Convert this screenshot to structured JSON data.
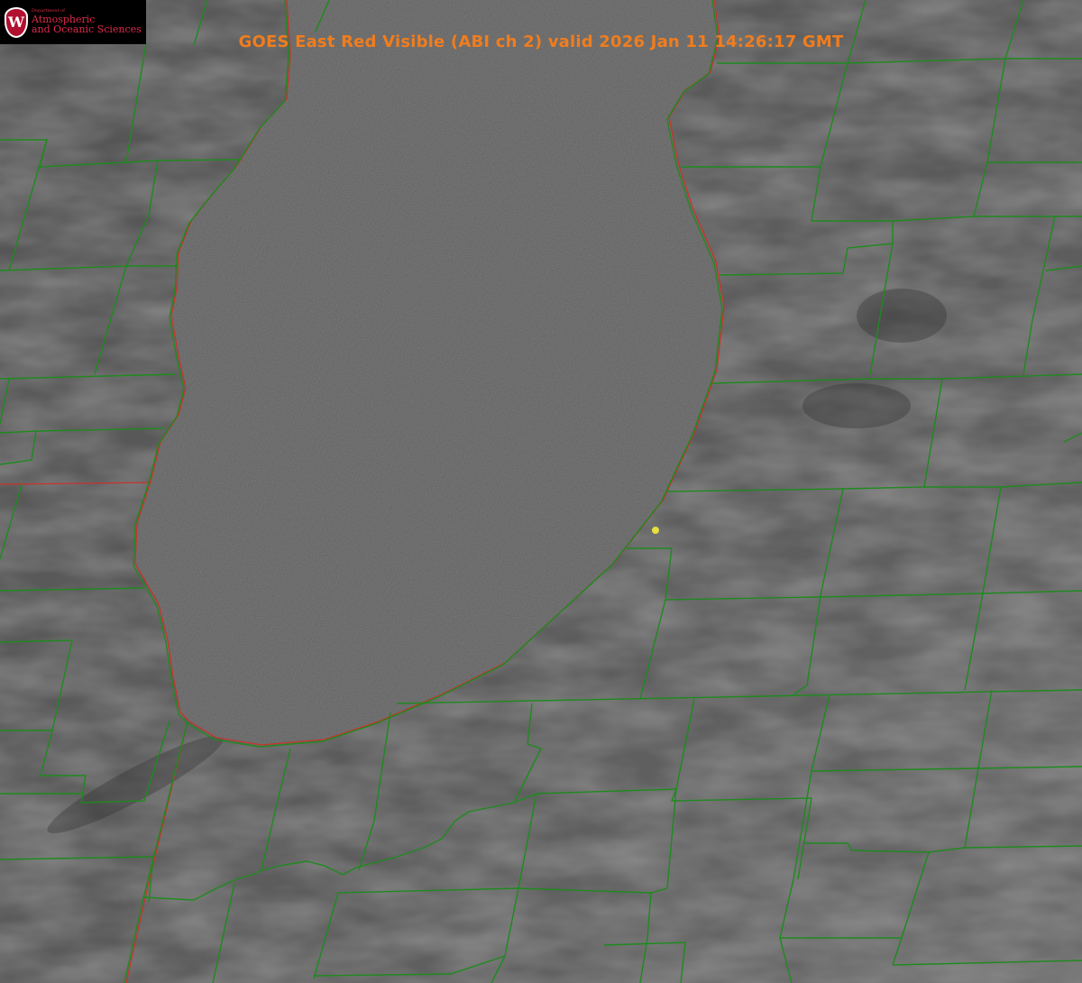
{
  "title": "GOES East Red Visible (ABI ch 2) valid 2026 Jan 11 14:26:17 GMT",
  "logo": {
    "badge_letter": "W",
    "department": "Department of",
    "line1": "Atmospheric",
    "line2": "and Oceanic Sciences"
  },
  "colors": {
    "county_lines": "#1e8a1e",
    "state_lines": "#c8322d",
    "title": "#f07d1e",
    "marker": "#e8e040",
    "logo_bg": "#000000",
    "logo_red": "#b2102f"
  },
  "map": {
    "feature": "lake-outline",
    "marker": "station-dot-yellow"
  }
}
